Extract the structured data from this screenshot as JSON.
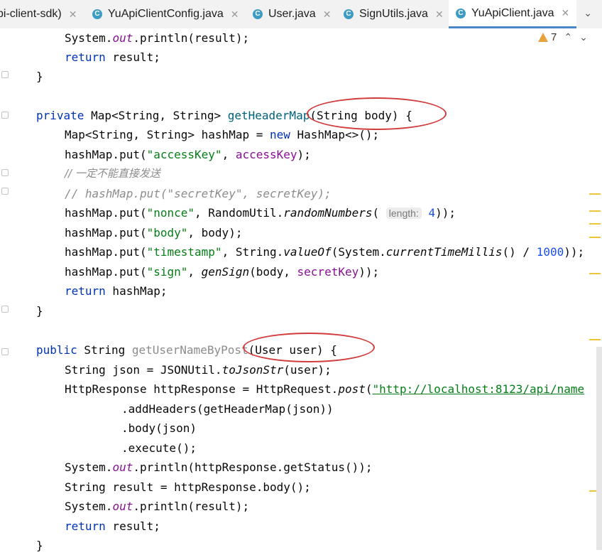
{
  "tabs": [
    {
      "label": "pi-client-sdk)",
      "icon": "",
      "active": false
    },
    {
      "label": "YuApiClientConfig.java",
      "icon": "class-icon",
      "active": false
    },
    {
      "label": "User.java",
      "icon": "class-icon",
      "active": false
    },
    {
      "label": "SignUtils.java",
      "icon": "class-icon",
      "active": false
    },
    {
      "label": "YuApiClient.java",
      "icon": "class-icon",
      "active": true
    }
  ],
  "inspection": {
    "warnings_count": "7"
  },
  "code": {
    "l1": {
      "a": "System.",
      "b": "out",
      "c": ".println(result);"
    },
    "l2": {
      "a": "return",
      "b": " result;"
    },
    "l3": "}",
    "l5": {
      "a": "private",
      "b": " Map<String, String> ",
      "c": "getHeaderMap",
      "d": "(String body) {"
    },
    "l6": {
      "a": "Map<String, String> hashMap = ",
      "b": "new",
      "c": " HashMap<>();"
    },
    "l7": {
      "a": "hashMap.put(",
      "b": "\"accessKey\"",
      "c": ", ",
      "d": "accessKey",
      "e": ");"
    },
    "l8": "// 一定不能直接发送",
    "l9": "// hashMap.put(\"secretKey\", secretKey);",
    "l10": {
      "a": "hashMap.put(",
      "b": "\"nonce\"",
      "c": ", RandomUtil.",
      "d": "randomNumbers",
      "e": "( ",
      "f": "length:",
      "g": " 4",
      "h": "));"
    },
    "l11": {
      "a": "hashMap.put(",
      "b": "\"body\"",
      "c": ", body);"
    },
    "l12": {
      "a": "hashMap.put(",
      "b": "\"timestamp\"",
      "c": ", String.",
      "d": "valueOf",
      "e": "(System.",
      "f": "currentTimeMillis",
      "g": "() / ",
      "h": "1000",
      "i": "));"
    },
    "l13": {
      "a": "hashMap.put(",
      "b": "\"sign\"",
      "c": ", ",
      "d": "genSign",
      "e": "(body, ",
      "f": "secretKey",
      "g": "));"
    },
    "l14": {
      "a": "return",
      "b": " hashMap;"
    },
    "l15": "}",
    "l17": {
      "a": "public",
      "b": " String ",
      "c": "getUserNameByPost",
      "d": "(User user) {"
    },
    "l18": {
      "a": "String json = JSONUtil.",
      "b": "toJsonStr",
      "c": "(user);"
    },
    "l19": {
      "a": "HttpResponse httpResponse = HttpRequest.",
      "b": "post",
      "c": "(",
      "d": "\"http://localhost:8123/api/name"
    },
    "l20": ".addHeaders(getHeaderMap(json))",
    "l21": ".body(json)",
    "l22": ".execute();",
    "l23": {
      "a": "System.",
      "b": "out",
      "c": ".println(httpResponse.getStatus());"
    },
    "l24": "String result = httpResponse.body();",
    "l25": {
      "a": "System.",
      "b": "out",
      "c": ".println(result);"
    },
    "l26": {
      "a": "return",
      "b": " result;"
    },
    "l27": "}"
  }
}
